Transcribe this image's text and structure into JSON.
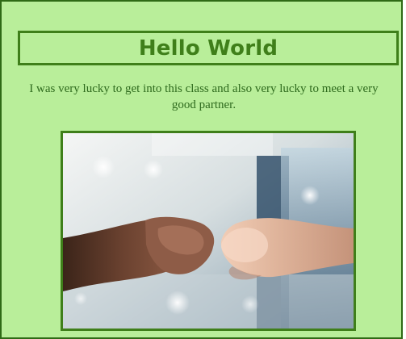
{
  "heading": {
    "text": "Hello World"
  },
  "description": {
    "text": "I was very lucky to get into this class and also very lucky to meet a very good partner."
  },
  "image": {
    "depicts": "two fists bumping"
  },
  "colors": {
    "page_background": "#b9ee9a",
    "accent_green": "#3f7f1a",
    "text_green": "#2e6a1d"
  }
}
